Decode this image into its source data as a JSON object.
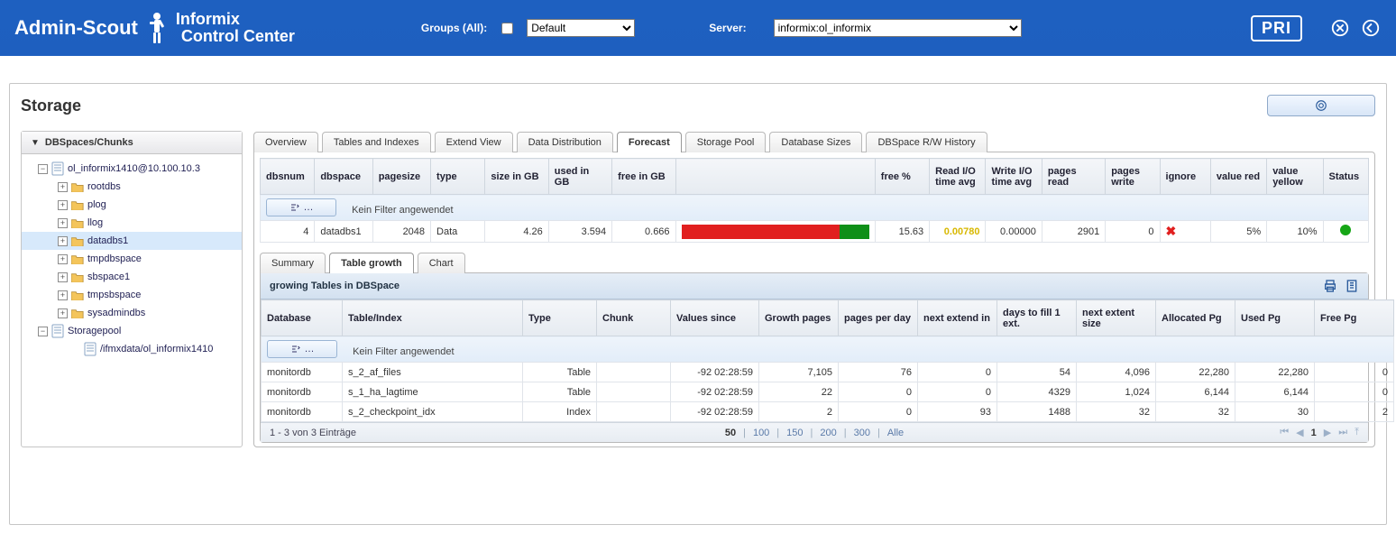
{
  "header": {
    "brand_main": "Admin-Scout",
    "brand_line1": "Informix",
    "brand_line2": "Control Center",
    "groups_label": "Groups (All):",
    "group_selected": "Default",
    "server_label": "Server:",
    "server_selected": "informix:ol_informix",
    "badge": "PRI"
  },
  "page": {
    "title": "Storage"
  },
  "sidebar": {
    "title": "DBSpaces/Chunks",
    "nodes": [
      {
        "exp": "−",
        "kind": "doc",
        "label": "ol_informix1410@10.100.10.3",
        "ind": 18,
        "sel": false
      },
      {
        "exp": "+",
        "kind": "folder",
        "label": "rootdbs",
        "ind": 40,
        "sel": false
      },
      {
        "exp": "+",
        "kind": "folder",
        "label": "plog",
        "ind": 40,
        "sel": false
      },
      {
        "exp": "+",
        "kind": "folder",
        "label": "llog",
        "ind": 40,
        "sel": false
      },
      {
        "exp": "+",
        "kind": "folder",
        "label": "datadbs1",
        "ind": 40,
        "sel": true
      },
      {
        "exp": "+",
        "kind": "folder",
        "label": "tmpdbspace",
        "ind": 40,
        "sel": false
      },
      {
        "exp": "+",
        "kind": "folder",
        "label": "sbspace1",
        "ind": 40,
        "sel": false
      },
      {
        "exp": "+",
        "kind": "folder",
        "label": "tmpsbspace",
        "ind": 40,
        "sel": false
      },
      {
        "exp": "+",
        "kind": "folder",
        "label": "sysadmindbs",
        "ind": 40,
        "sel": false
      },
      {
        "exp": "−",
        "kind": "doc",
        "label": "Storagepool",
        "ind": 18,
        "sel": false
      },
      {
        "exp": "",
        "kind": "doc",
        "label": "/ifmxdata/ol_informix1410",
        "ind": 54,
        "sel": false
      }
    ]
  },
  "tabs": {
    "items": [
      "Overview",
      "Tables and Indexes",
      "Extend View",
      "Data Distribution",
      "Forecast",
      "Storage Pool",
      "Database Sizes",
      "DBSpace R/W History"
    ],
    "active": 4
  },
  "top_grid": {
    "headers": [
      "dbsnum",
      "dbspace",
      "pagesize",
      "type",
      "size in GB",
      "used in GB",
      "free in GB",
      "",
      "free %",
      "Read I/O time avg",
      "Write I/O time avg",
      "pages read",
      "pages write",
      "ignore",
      "value red",
      "value yellow",
      "Status"
    ],
    "filter_text": "Kein Filter angewendet",
    "row": {
      "dbsnum": "4",
      "dbspace": "datadbs1",
      "pagesize": "2048",
      "type": "Data",
      "size": "4.26",
      "used": "3.594",
      "free": "0.666",
      "free_pct": "15.63",
      "read_io": "0.00780",
      "write_io": "0.00000",
      "pages_read": "2901",
      "pages_write": "0",
      "ignore": "✖",
      "value_red": "5%",
      "value_yellow": "10%",
      "used_pct_bar": 84.37
    }
  },
  "subtabs": {
    "items": [
      "Summary",
      "Table growth",
      "Chart"
    ],
    "active": 1
  },
  "growth": {
    "title": "growing Tables in DBSpace",
    "headers": [
      "Database",
      "Table/Index",
      "Type",
      "Chunk",
      "Values since",
      "Growth pages",
      "pages per day",
      "next extend in",
      "days to fill 1 ext.",
      "next extent size",
      "Allocated Pg",
      "Used Pg",
      "Free Pg"
    ],
    "filter_text": "Kein Filter angewendet",
    "rows": [
      {
        "db": "monitordb",
        "ti": "s_2_af_files",
        "type": "Table",
        "chunk": "",
        "since": "-92 02:28:59",
        "growth": "7,105",
        "ppd": "76",
        "nei": "0",
        "days": "54",
        "nes": "4,096",
        "alloc": "22,280",
        "used": "22,280",
        "free": "0"
      },
      {
        "db": "monitordb",
        "ti": "s_1_ha_lagtime",
        "type": "Table",
        "chunk": "",
        "since": "-92 02:28:59",
        "growth": "22",
        "ppd": "0",
        "nei": "0",
        "days": "4329",
        "nes": "1,024",
        "alloc": "6,144",
        "used": "6,144",
        "free": "0"
      },
      {
        "db": "monitordb",
        "ti": "s_2_checkpoint_idx",
        "type": "Index",
        "chunk": "",
        "since": "-92 02:28:59",
        "growth": "2",
        "ppd": "0",
        "nei": "93",
        "days": "1488",
        "nes": "32",
        "alloc": "32",
        "used": "30",
        "free": "2"
      }
    ],
    "pager": {
      "summary": "1 - 3 von 3 Einträge",
      "sizes": [
        "50",
        "100",
        "150",
        "200",
        "300",
        "Alle"
      ],
      "size_active": 0,
      "page": "1"
    }
  }
}
